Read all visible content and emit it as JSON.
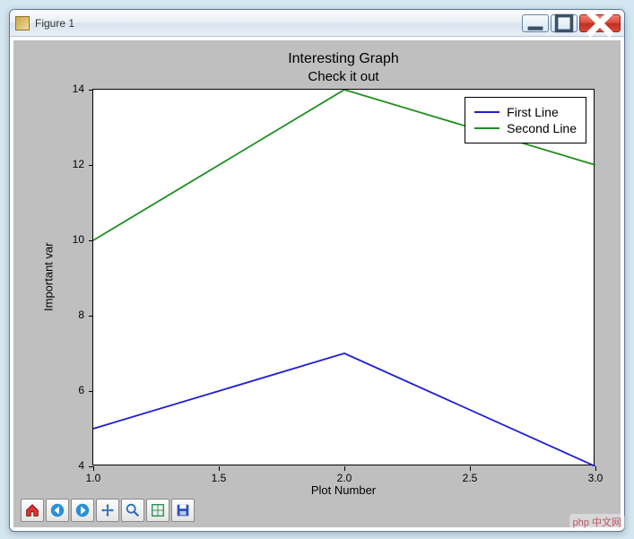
{
  "window": {
    "title": "Figure 1"
  },
  "chart_data": {
    "type": "line",
    "title": "Interesting Graph",
    "subtitle": "Check it out",
    "xlabel": "Plot Number",
    "ylabel": "Important var",
    "x": [
      1.0,
      2.0,
      3.0
    ],
    "series": [
      {
        "name": "First Line",
        "color": "#1f1fd6",
        "values": [
          5,
          7,
          4
        ]
      },
      {
        "name": "Second Line",
        "color": "#1f8f1f",
        "values": [
          10,
          14,
          12
        ]
      }
    ],
    "xticks": [
      1.0,
      1.5,
      2.0,
      2.5,
      3.0
    ],
    "yticks": [
      4,
      6,
      8,
      10,
      12,
      14
    ],
    "xlim": [
      1.0,
      3.0
    ],
    "ylim": [
      4,
      14
    ],
    "legend_position": "upper right"
  },
  "toolbar": {
    "items": [
      "home",
      "back",
      "forward",
      "pan",
      "zoom",
      "subplots",
      "save"
    ]
  },
  "watermark": "php 中文网"
}
